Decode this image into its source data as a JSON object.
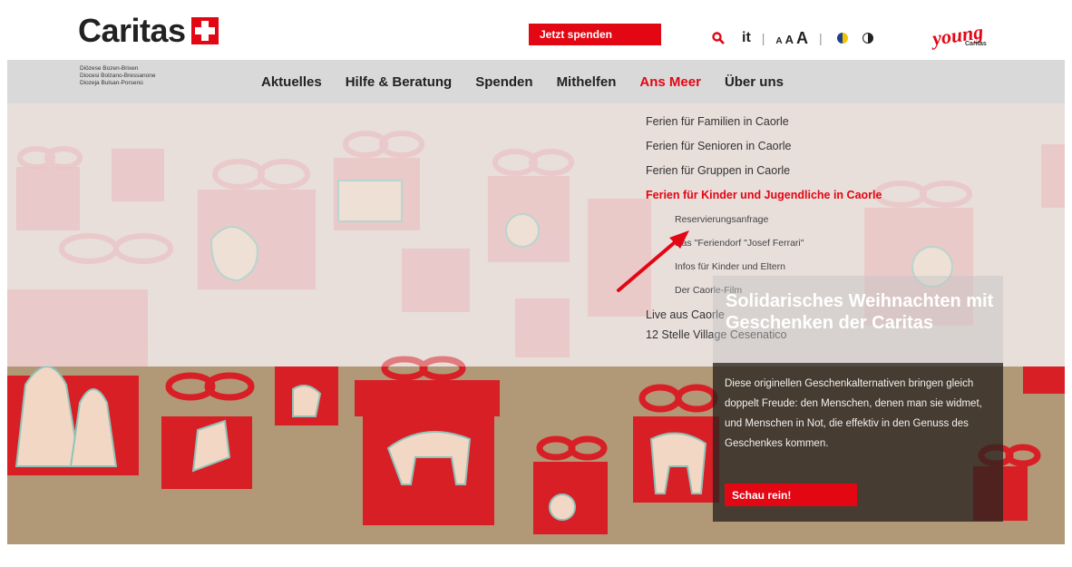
{
  "brand": {
    "name": "Caritas",
    "accent": "#e30613"
  },
  "header": {
    "donate_label": "Jetzt spenden",
    "language": "it",
    "font_sizes": [
      "A",
      "A",
      "A"
    ],
    "young_logo": "young",
    "young_sub": "Caritas"
  },
  "diocese": [
    "Diözese Bozen-Brixen",
    "Diocesi Bolzano-Bressanone",
    "Diozeja Bulsan-Porsenù"
  ],
  "nav": {
    "items": [
      {
        "label": "Aktuelles"
      },
      {
        "label": "Hilfe & Beratung"
      },
      {
        "label": "Spenden"
      },
      {
        "label": "Mithelfen"
      },
      {
        "label": "Ans Meer",
        "active": true
      },
      {
        "label": "Über uns"
      }
    ]
  },
  "dropdown": {
    "items": [
      "Ferien für Familien in Caorle",
      "Ferien für Senioren in Caorle",
      "Ferien für Gruppen in Caorle",
      "Ferien für Kinder und Jugendliche in Caorle"
    ],
    "subitems": [
      "Reservierungsanfrage",
      "Das \"Feriendorf \"Josef Ferrari\"",
      "Infos für Kinder und Eltern",
      "Der Caorle-Film"
    ],
    "more": [
      "Live aus Caorle",
      "12 Stelle Village Cesenatico"
    ]
  },
  "promo": {
    "title": "Solidarisches Weihnachten mit Geschenken der Caritas",
    "text": "Diese originellen Geschenkalternativen bringen gleich doppelt Freude: den Menschen, denen man sie widmet, und Menschen in Not, die effektiv in den Genuss des Geschenkes kommen.",
    "button": "Schau rein!"
  }
}
